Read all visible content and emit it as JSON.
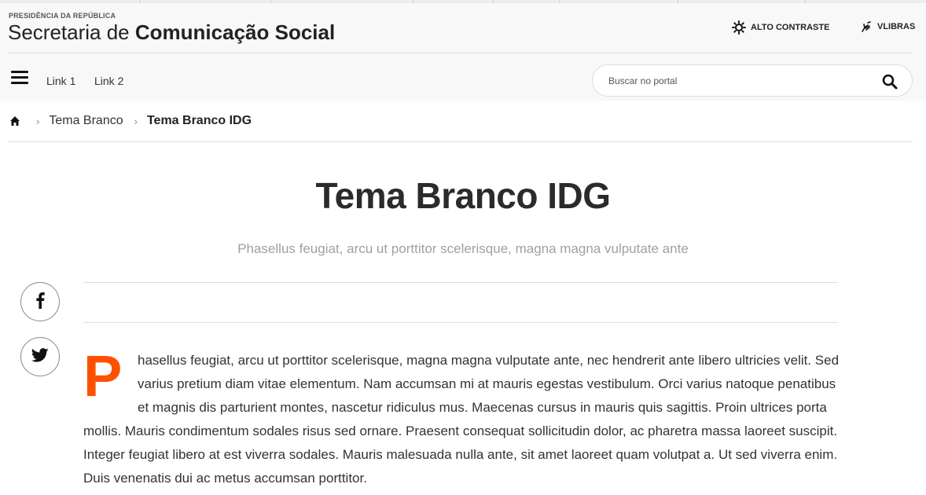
{
  "header": {
    "org_label": "PRESIDÊNCIA DA REPÚBLICA",
    "title_light": "Secretaria de",
    "title_bold": "Comunicação Social",
    "contrast_label": "ALTO CONTRASTE",
    "vlibras_label": "VLIBRAS",
    "contrast_icon": "sun-contrast-icon",
    "vlibras_icon": "sign-language-hand-icon"
  },
  "nav": {
    "menu_icon": "hamburger-menu-icon",
    "links": [
      "Link 1",
      "Link 2"
    ]
  },
  "search": {
    "placeholder": "Buscar no portal",
    "value": "",
    "icon": "search-icon"
  },
  "breadcrumb": {
    "home_icon": "home-icon",
    "separator_icon": "chevron-right-icon",
    "items": [
      "Tema Branco",
      "Tema Branco IDG"
    ]
  },
  "article": {
    "title": "Tema Branco IDG",
    "description": "Phasellus feugiat, arcu ut porttitor scelerisque, magna magna vulputate ante",
    "drop_cap": "P",
    "body": "hasellus feugiat, arcu ut porttitor scelerisque, magna magna vulputate ante, nec hendrerit ante libero ultricies velit. Sed varius pretium diam vitae elementum. Nam accumsan mi at mauris egestas vestibulum. Orci varius natoque penatibus et magnis dis parturient montes, nascetur ridiculus mus. Maecenas cursus in mauris quis sagittis. Proin ultrices porta mollis. Mauris condimentum sodales risus sed ornare. Praesent consequat sollicitudin dolor, ac pharetra massa laoreet suscipit. Integer feugiat libero at est viverra sodales. Mauris malesuada nulla ante, sit amet laoreet quam volutpat a. Ut sed viverra enim. Duis venenatis dui ac metus accumsan porttitor."
  },
  "share": {
    "facebook_icon": "facebook-icon",
    "twitter_icon": "twitter-icon"
  },
  "colors": {
    "accent": "#ff5000",
    "header_bg": "#f8f8f8",
    "title_text": "#2b2b2b",
    "muted_text": "#a0a0a0"
  }
}
